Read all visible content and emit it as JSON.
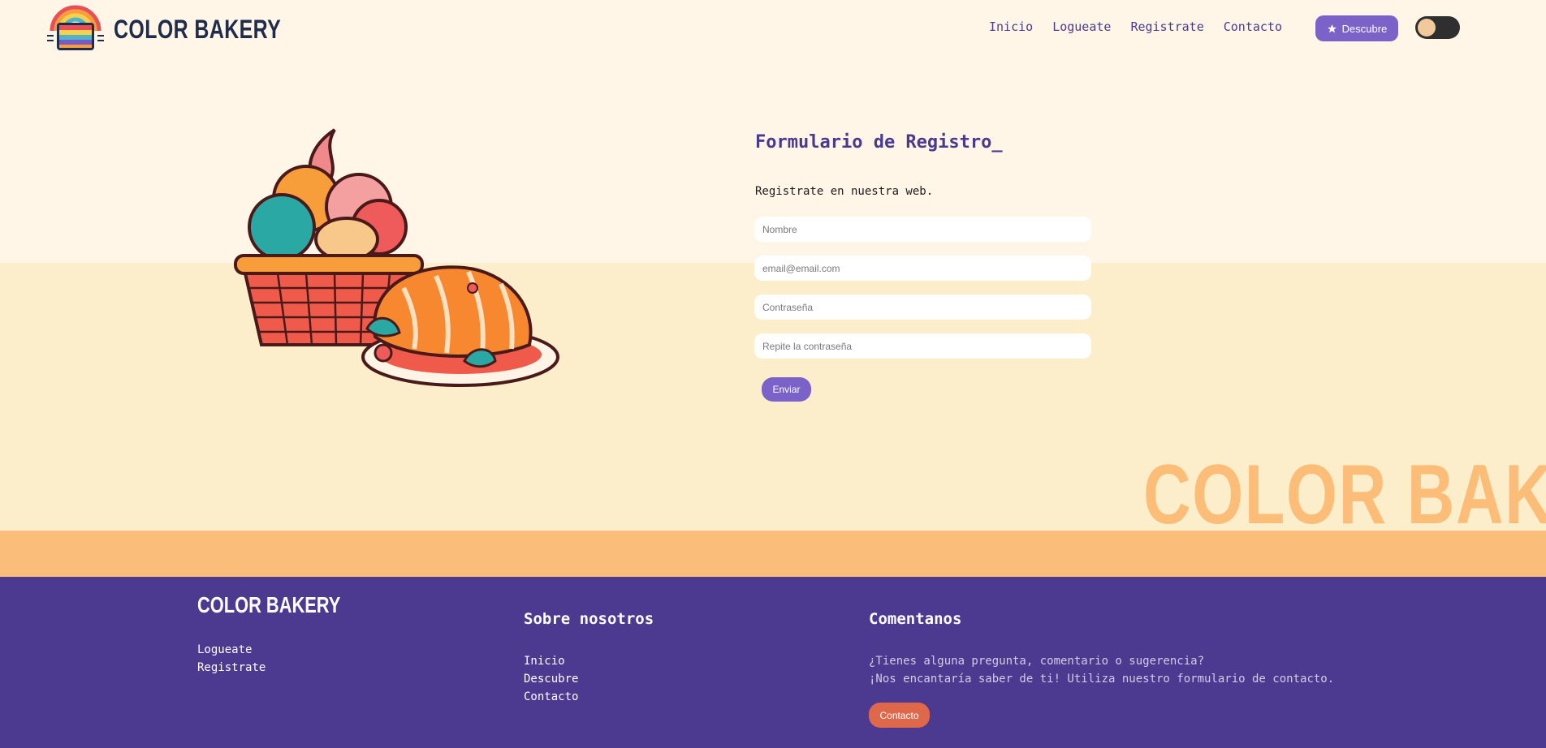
{
  "header": {
    "brand": "COLOR BAKERY",
    "nav": [
      "Inicio",
      "Logueate",
      "Registrate",
      "Contacto"
    ],
    "discover_label": "Descubre",
    "discover_icon": "star-icon",
    "theme_toggle_icon": "theme-toggle"
  },
  "form": {
    "title": "Formulario de Registro_",
    "subtitle": "Registrate en nuestra web.",
    "name_placeholder": "Nombre",
    "email_placeholder": "email@email.com",
    "password_placeholder": "Contraseña",
    "repeat_placeholder": "Repite la contraseña",
    "submit_label": "Enviar"
  },
  "hero": {
    "illustration_icon": "bakery-basket-illustration",
    "watermark": "COLOR BAKERY"
  },
  "footer": {
    "brand": "COLOR BAKERY",
    "links": [
      "Logueate",
      "Registrate"
    ],
    "about_title": "Sobre nosotros",
    "about_links": [
      "Inicio",
      "Descubre",
      "Contacto"
    ],
    "comment_title": "Comentanos",
    "comment_line1": "¿Tienes alguna pregunta, comentario o sugerencia?",
    "comment_line2": "¡Nos encantaría saber de ti! Utiliza nuestro formulario de contacto.",
    "contact_label": "Contacto"
  },
  "colors": {
    "accent": "#7b62c8",
    "footer_bg": "#4b3a8f",
    "orange": "#fbbd7a",
    "contact_btn": "#e0684a"
  }
}
